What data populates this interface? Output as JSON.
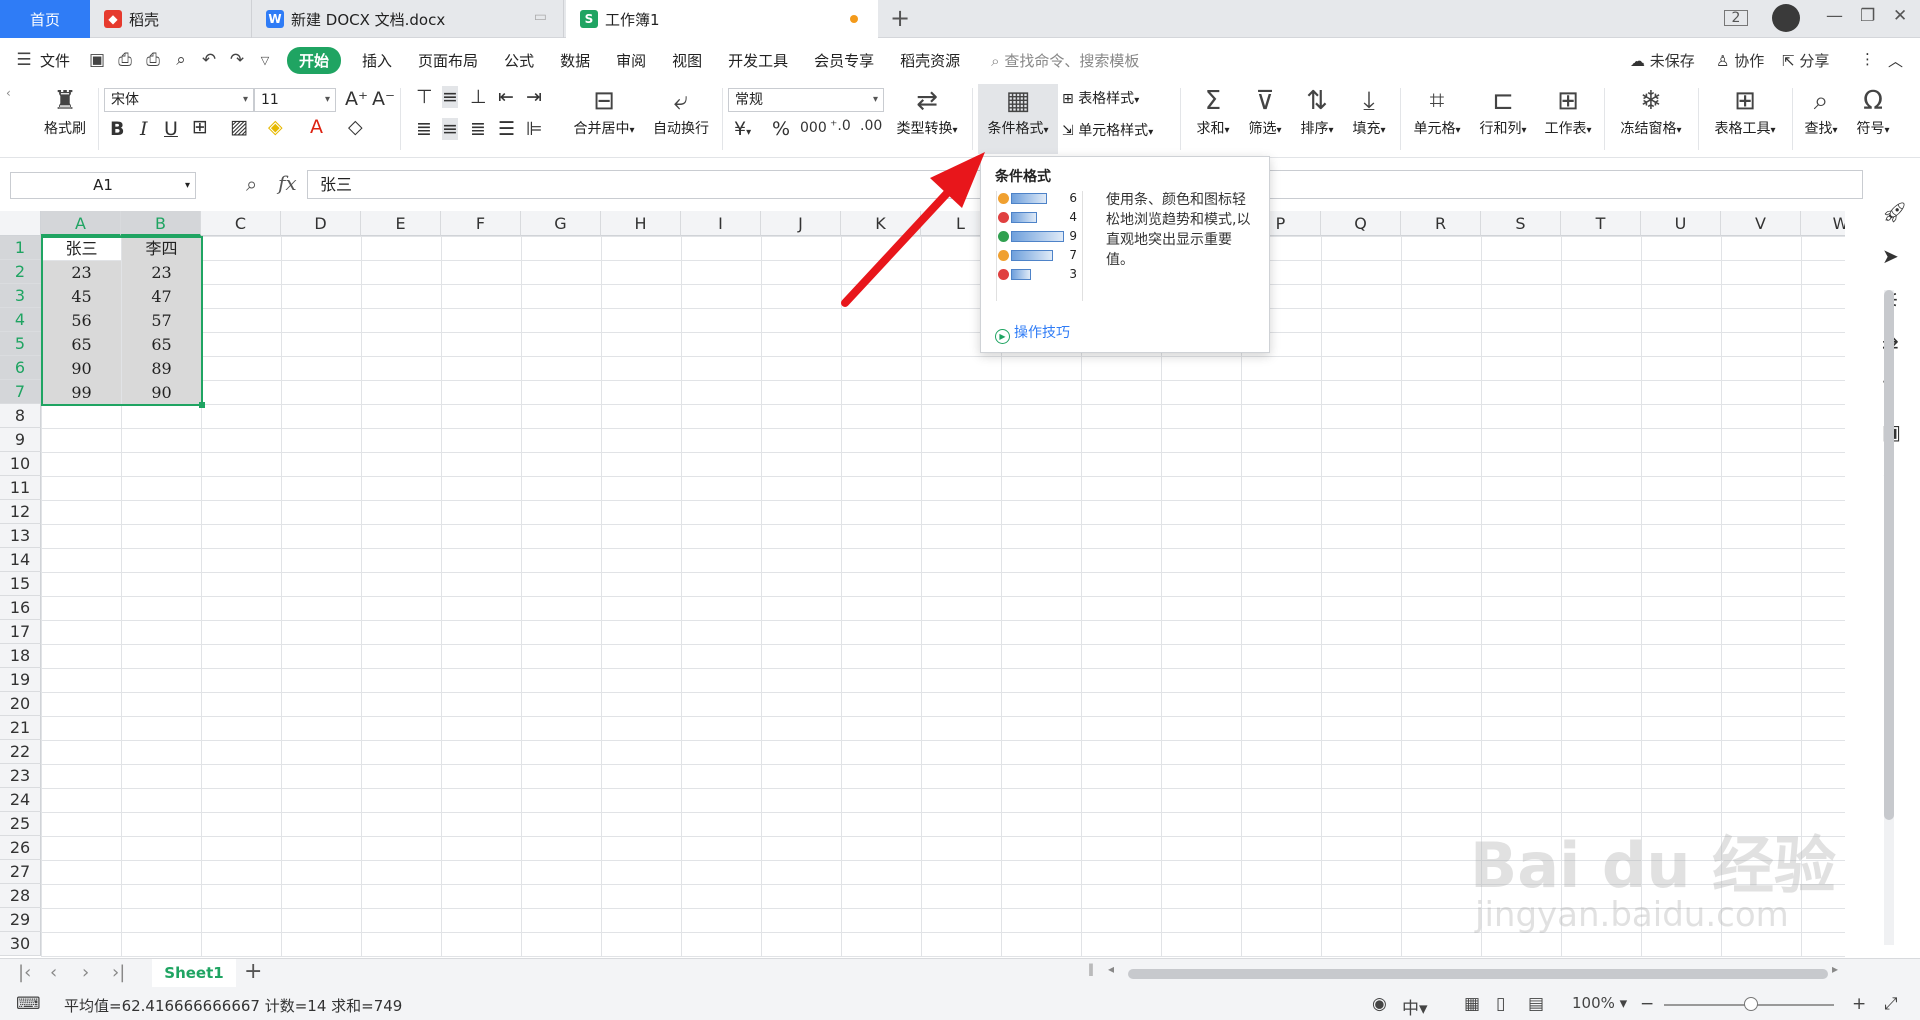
{
  "tabs": {
    "home": "首页",
    "daoke": "稻壳",
    "docx": "新建 DOCX 文档.docx",
    "workbook": "工作簿1"
  },
  "menu": {
    "file": "文件",
    "items": [
      "开始",
      "插入",
      "页面布局",
      "公式",
      "数据",
      "审阅",
      "视图",
      "开发工具",
      "会员专享",
      "稻壳资源"
    ],
    "search_placeholder": "查找命令、搜索模板",
    "unsaved": "未保存",
    "collaborate": "协作",
    "share": "分享"
  },
  "ribbon": {
    "format_painter": "格式刷",
    "font_name": "宋体",
    "font_size": "11",
    "merge_center": "合并居中",
    "auto_wrap": "自动换行",
    "number_format": "常规",
    "type_convert": "类型转换",
    "conditional_format": "条件格式",
    "table_style": "表格样式",
    "cell_style": "单元格样式",
    "sum": "求和",
    "filter": "筛选",
    "sort": "排序",
    "fill": "填充",
    "cell": "单元格",
    "row_col": "行和列",
    "worksheet": "工作表",
    "freeze": "冻结窗格",
    "table_tools": "表格工具",
    "find": "查找",
    "symbol": "符号",
    "currency": "¥"
  },
  "formula_bar": {
    "name_box": "A1",
    "fx": "fx",
    "content": "张三"
  },
  "columns": [
    "A",
    "B",
    "C",
    "D",
    "E",
    "F",
    "G",
    "H",
    "I",
    "J",
    "K",
    "L",
    "M",
    "N",
    "O",
    "P",
    "Q",
    "R",
    "S",
    "T",
    "U",
    "V",
    "W"
  ],
  "rows": [
    "1",
    "2",
    "3",
    "4",
    "5",
    "6",
    "7",
    "8",
    "9",
    "10",
    "11",
    "12",
    "13",
    "14",
    "15",
    "16",
    "17",
    "18",
    "19",
    "20",
    "21",
    "22",
    "23",
    "24",
    "25",
    "26",
    "27",
    "28",
    "29",
    "30"
  ],
  "cells": [
    [
      "张三",
      "李四"
    ],
    [
      "23",
      "23"
    ],
    [
      "45",
      "47"
    ],
    [
      "56",
      "57"
    ],
    [
      "65",
      "65"
    ],
    [
      "90",
      "89"
    ],
    [
      "99",
      "90"
    ]
  ],
  "popup": {
    "title": "条件格式",
    "description": "使用条、颜色和图标轻松地浏览趋势和模式,以直观地突出显示重要值。",
    "preview": [
      {
        "value": "6",
        "fill": 0.6,
        "icon_color": "#f0a030"
      },
      {
        "value": "4",
        "fill": 0.4,
        "icon_color": "#e04040"
      },
      {
        "value": "9",
        "fill": 0.9,
        "icon_color": "#30a050"
      },
      {
        "value": "7",
        "fill": 0.7,
        "icon_color": "#f0a030"
      },
      {
        "value": "3",
        "fill": 0.3,
        "icon_color": "#e04040"
      }
    ],
    "tip": "操作技巧"
  },
  "sheet": {
    "name": "Sheet1"
  },
  "status": {
    "summary": "平均值=62.416666666667 计数=14 求和=749",
    "zoom": "100%"
  },
  "watermark": {
    "brand": "Bai du 经验",
    "url": "jingyan.baidu.com"
  },
  "colors": {
    "accent_green": "#1fa462",
    "tab_blue": "#2f7cf6",
    "arrow_red": "#e8161b"
  }
}
